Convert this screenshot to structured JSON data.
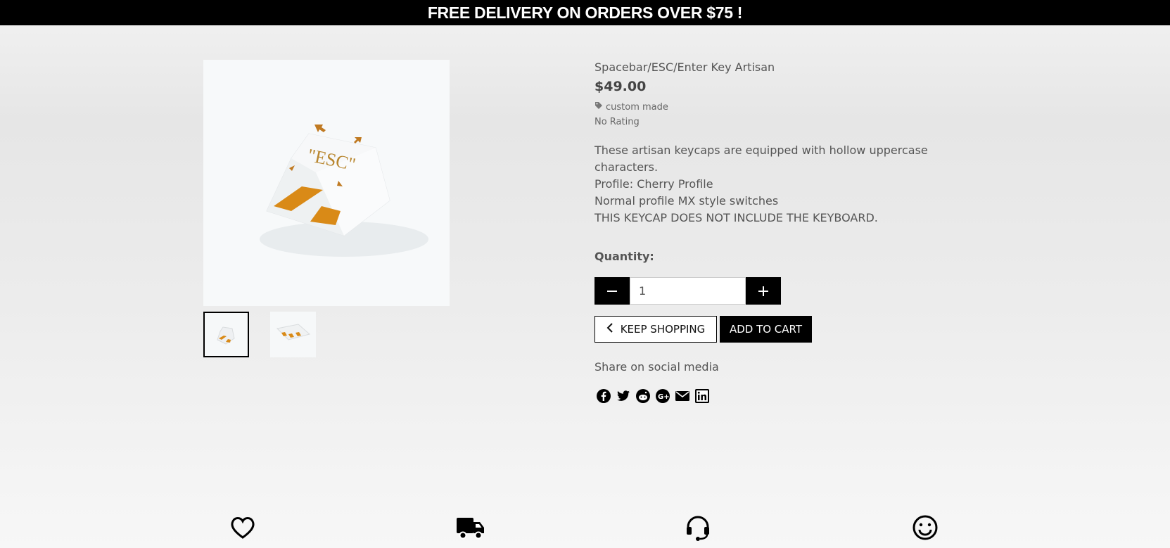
{
  "banner": {
    "text": "FREE DELIVERY ON ORDERS OVER $75 !"
  },
  "product": {
    "title": "Spacebar/ESC/Enter Key Artisan",
    "price": "$49.00",
    "tag": "custom made",
    "rating": "No Rating",
    "main_image_keycap_text": "\"ESC\"",
    "description": [
      "These artisan keycaps are equipped with hollow uppercase",
      "characters.",
      "Profile: Cherry Profile",
      "Normal profile MX style switches",
      "THIS KEYCAP DOES NOT INCLUDE THE KEYBOARD."
    ]
  },
  "quantity": {
    "label": "Quantity:",
    "value": "1"
  },
  "buttons": {
    "keep_shopping": "KEEP SHOPPING",
    "add_to_cart": "ADD TO CART"
  },
  "share": {
    "label": "Share on social media",
    "icons": [
      "facebook-icon",
      "twitter-icon",
      "reddit-icon",
      "google-plus-icon",
      "email-icon",
      "linkedin-icon"
    ]
  },
  "features": [
    "heart-icon",
    "truck-icon",
    "headset-icon",
    "smiley-icon"
  ],
  "colors": {
    "accent": "#000000",
    "keycap_orange": "#d98a17"
  }
}
